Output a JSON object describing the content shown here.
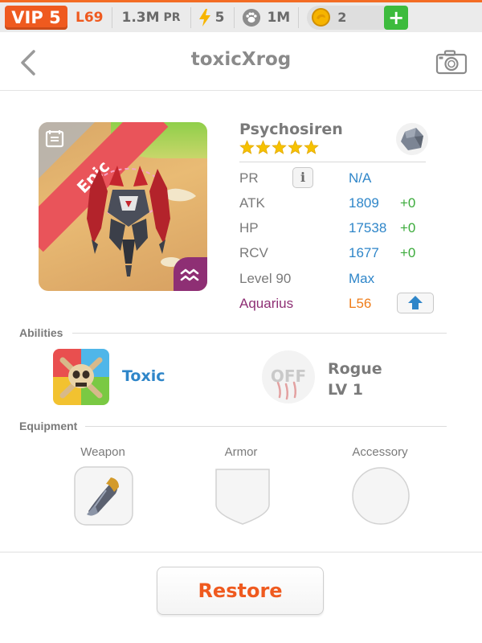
{
  "statusbar": {
    "vip_label": "VIP 5",
    "level": "L69",
    "pr_value": "1.3M",
    "pr_unit": "PR",
    "energy": "5",
    "paw_count": "1M",
    "coins": "2",
    "plus_label": "+",
    "accent_color": "#ef5a1f"
  },
  "header": {
    "title": "toxicXrog",
    "back_icon": "chevron-left-icon",
    "camera_icon": "camera-icon"
  },
  "monster": {
    "rarity": "Epic",
    "name": "Psychosiren",
    "stars": 5,
    "stats": [
      {
        "label": "PR",
        "value": "N/A",
        "bonus": ""
      },
      {
        "label": "ATK",
        "value": "1809",
        "bonus": "+0"
      },
      {
        "label": "HP",
        "value": "17538",
        "bonus": "+0"
      },
      {
        "label": "RCV",
        "value": "1677",
        "bonus": "+0"
      }
    ],
    "level_label": "Level 90",
    "level_value": "Max",
    "constellation_label": "Aquarius",
    "constellation_value": "L56",
    "info_label": "i"
  },
  "abilities": {
    "section_title": "Abilities",
    "primary": {
      "name": "Toxic"
    },
    "secondary": {
      "badge": "OFF",
      "name": "Rogue",
      "level": "LV 1"
    }
  },
  "equipment": {
    "section_title": "Equipment",
    "slots": [
      {
        "label": "Weapon"
      },
      {
        "label": "Armor"
      },
      {
        "label": "Accessory"
      }
    ]
  },
  "footer": {
    "restore_label": "Restore"
  }
}
